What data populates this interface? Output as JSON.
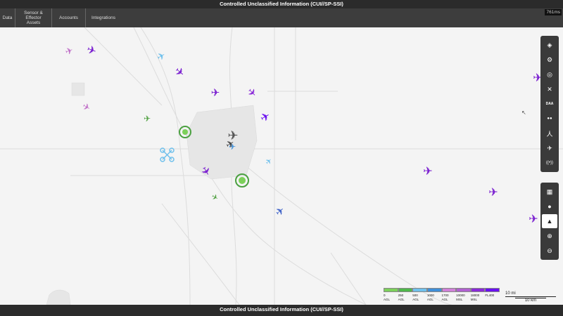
{
  "banner": {
    "top_text": "Controlled Unclassified Information (CUI//SP-SSI)",
    "bottom_text": "Controlled Unclassified Information (CUI//SP-SSI)"
  },
  "nav": {
    "items": [
      {
        "label": "Data"
      },
      {
        "label": "Sensor & Effector Assets"
      },
      {
        "label": "Accounts"
      },
      {
        "label": "Integrations"
      }
    ]
  },
  "latency": "761ms",
  "toolbar_top": {
    "tools": [
      {
        "icon": "layers-icon",
        "glyph": "◈"
      },
      {
        "icon": "gear-icon",
        "glyph": "⚙"
      },
      {
        "icon": "target-icon",
        "glyph": "◎"
      },
      {
        "icon": "tools-icon",
        "glyph": "✕"
      },
      {
        "icon": "daa-icon",
        "label": "DAA"
      },
      {
        "icon": "binoculars-icon",
        "glyph": "●●"
      },
      {
        "icon": "person-icon",
        "glyph": "⼈"
      },
      {
        "icon": "helicopter-icon",
        "glyph": "✈"
      },
      {
        "icon": "broadcast-icon",
        "glyph": "((•))"
      }
    ]
  },
  "toolbar_bottom": {
    "tools": [
      {
        "icon": "map-icon",
        "glyph": "▦"
      },
      {
        "icon": "pin-icon",
        "glyph": "●"
      },
      {
        "icon": "north-arrow-icon",
        "glyph": "▲",
        "active": true
      },
      {
        "icon": "zoom-in-icon",
        "glyph": "⊕"
      },
      {
        "icon": "zoom-out-icon",
        "glyph": "⊖"
      }
    ]
  },
  "legend": {
    "colors": [
      "#7cd05a",
      "#4fb84a",
      "#6fc0ec",
      "#3f8fd8",
      "#d080d8",
      "#b060d0",
      "#8a2ad8",
      "#6a10f0"
    ],
    "labels": [
      {
        "value": "0",
        "unit": "AGL"
      },
      {
        "value": "250",
        "unit": "AGL"
      },
      {
        "value": "500",
        "unit": "AGL"
      },
      {
        "value": "1000",
        "unit": "AGL"
      },
      {
        "value": "1700",
        "unit": "AGL"
      },
      {
        "value": "10000",
        "unit": "MSL"
      },
      {
        "value": "18000",
        "unit": "MSL"
      },
      {
        "value": "FL400",
        "unit": ""
      }
    ]
  },
  "scale": {
    "miles": "10 mi",
    "km": "10 km"
  }
}
